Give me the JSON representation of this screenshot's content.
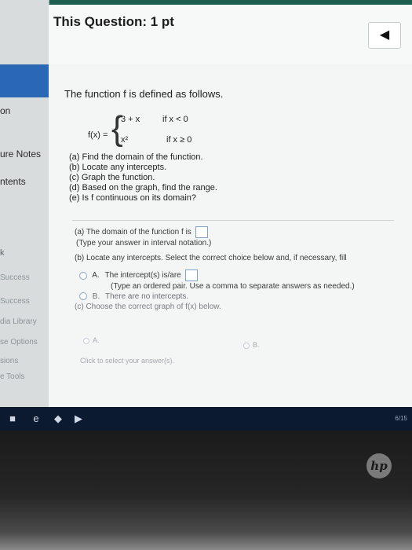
{
  "header": {
    "title": "This Question: 1 pt",
    "back_icon": "◀"
  },
  "sidebar": {
    "items": [
      {
        "label": "on"
      },
      {
        "label": "ure Notes"
      },
      {
        "label": "ntents"
      },
      {
        "label": "k"
      },
      {
        "label": "Success"
      },
      {
        "label": "Success"
      },
      {
        "label": "dia Library"
      },
      {
        "label": "se Options"
      },
      {
        "label": "sions"
      },
      {
        "label": "e Tools"
      }
    ]
  },
  "question": {
    "intro": "The function f is defined as follows.",
    "fx_label": "f(x) =",
    "case1_expr": "3 + x",
    "case1_cond": "if  x < 0",
    "case2_expr": "x²",
    "case2_cond": "if  x ≥ 0",
    "parts": [
      "(a) Find the domain of the function.",
      "(b) Locate any intercepts.",
      "(c) Graph the function.",
      "(d) Based on the graph, find the range.",
      "(e) Is f continuous on its domain?"
    ]
  },
  "answer": {
    "a_label": "(a) The domain of the function f is",
    "a_hint": "(Type your answer in interval notation.)",
    "b_label": "(b) Locate any intercepts. Select the correct choice below and, if necessary, fill",
    "choice_a_label": "A.",
    "choice_a_text": "The intercept(s) is/are",
    "choice_a_hint": "(Type an ordered pair. Use a comma to separate answers as needed.)",
    "choice_b_label": "B.",
    "choice_b_text": "There are no intercepts.",
    "c_label": "(c) Choose the correct graph of f(x) below.",
    "graph_a": "A.",
    "graph_b": "B.",
    "click_hint": "Click to select your answer(s)."
  },
  "taskbar": {
    "time": "6/15"
  },
  "colors": {
    "accent": "#2a67b4",
    "taskbar": "#0c1a30"
  }
}
